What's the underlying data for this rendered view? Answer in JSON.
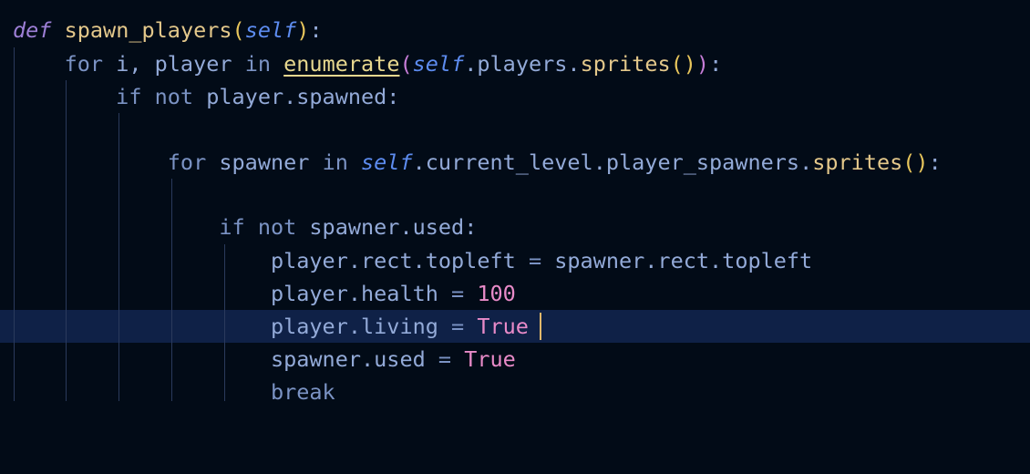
{
  "editor": {
    "language": "python",
    "current_line": 10,
    "lines": [
      "def spawn_players(self):",
      "    for i, player in enumerate(self.players.sprites()):",
      "        if not player.spawned:",
      "",
      "            for spawner in self.current_level.player_spawners.sprites():",
      "",
      "                if not spawner.used:",
      "                    player.rect.topleft = spawner.rect.topleft",
      "                    player.health = 100",
      "                    player.living = True",
      "                    spawner.used = True",
      "                    break"
    ]
  },
  "colors": {
    "background": "#020b17",
    "current_line_highlight": "#0f2147",
    "caret": "#e2b86b",
    "indent_guide": "#2a3a5c"
  }
}
